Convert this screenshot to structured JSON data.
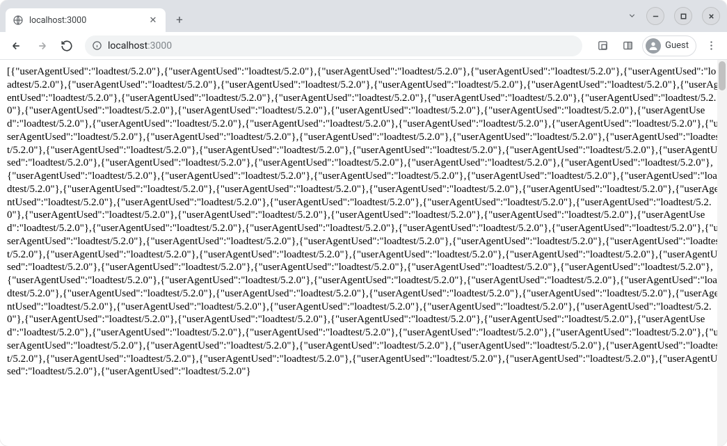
{
  "tab": {
    "title": "localhost:3000"
  },
  "address": {
    "host": "localhost",
    "port": ":3000"
  },
  "profile": {
    "label": "Guest"
  },
  "response": {
    "key": "userAgentUsed",
    "value": "loadtest/5.2.0",
    "visible_items_count": 108
  }
}
